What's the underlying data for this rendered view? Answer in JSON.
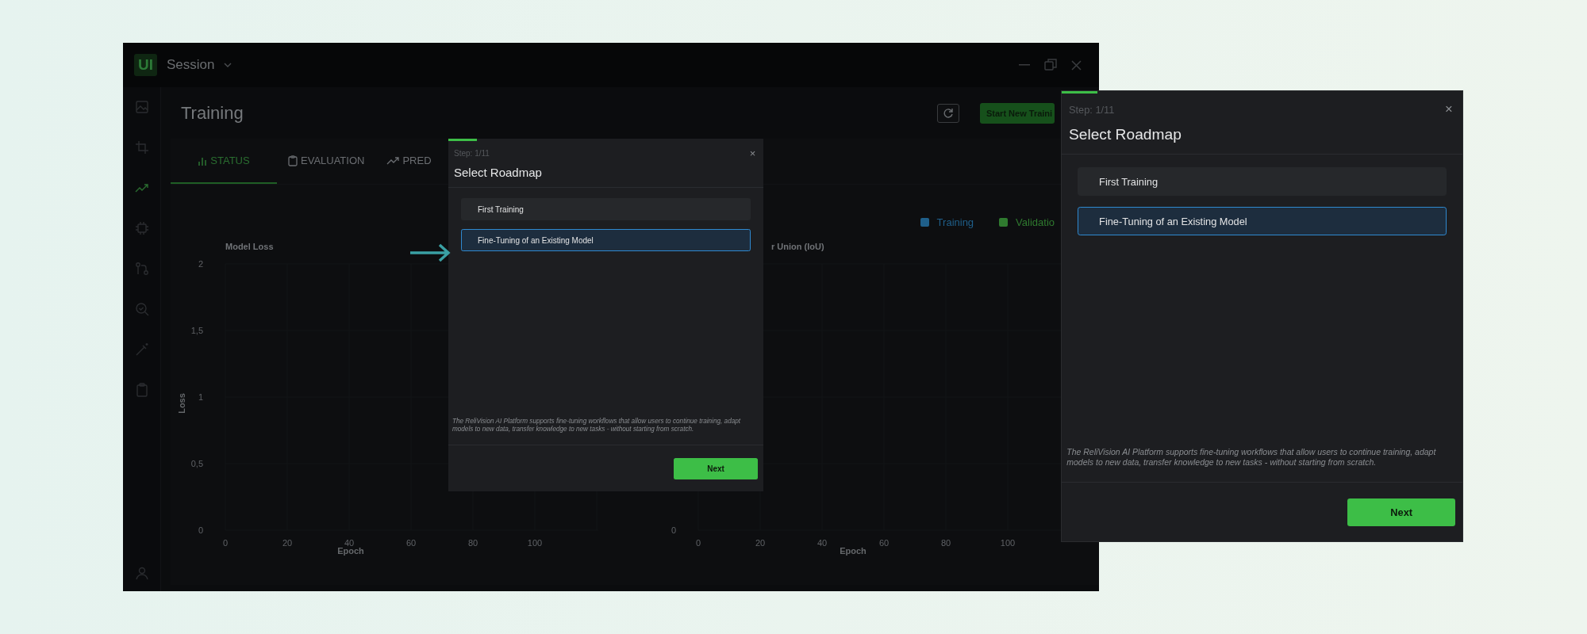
{
  "app": {
    "logo": "UI",
    "session": "Session",
    "sidebar": {
      "items": [
        {
          "selected": false
        },
        {
          "selected": false
        },
        {
          "selected": true
        },
        {
          "selected": false
        },
        {
          "selected": false
        },
        {
          "selected": false
        },
        {
          "selected": false
        },
        {
          "selected": false
        },
        {
          "selected": false
        }
      ]
    },
    "page_title": "Training",
    "start_button": "Start New Traini",
    "tabs": [
      {
        "label": "STATUS",
        "selected": true
      },
      {
        "label": "EVALUATION",
        "selected": false
      },
      {
        "label": "PRED",
        "selected": false
      }
    ],
    "legend": [
      {
        "label": "Training",
        "color": "#1f5f8a"
      },
      {
        "label": "Validatio",
        "color": "#2f7a2f"
      }
    ],
    "charts": [
      {
        "title": "Model Loss",
        "ylabel": "Loss",
        "xlabel": "Epoch",
        "xticks": [
          "0",
          "20",
          "40",
          "60",
          "80",
          "100"
        ],
        "yticks": [
          "2",
          "1,5",
          "1",
          "0,5",
          "0"
        ]
      },
      {
        "title": "r Union (IoU)",
        "xlabel": "Epoch",
        "xticks": [
          "0",
          "20",
          "40",
          "60",
          "80",
          "100"
        ],
        "yticks": [
          "0"
        ]
      }
    ]
  },
  "modal_dialog": {
    "level": 0.09,
    "step": "Step: 1/11",
    "close": "×",
    "title": "Select Roadmap",
    "options": [
      {
        "label": "First Training",
        "selected": false
      },
      {
        "label": "Fine-Tuning of an Existing Model",
        "selected": true
      }
    ],
    "description": "The ReliVision AI Platform supports fine-tuning workflows that allow users to continue training, adapt models to new data, transfer knowledge to new tasks - without starting from scratch.",
    "next": "Next"
  },
  "magnified_dialog": {
    "level": 0.09,
    "step": "Step: 1/11",
    "close": "×",
    "title": "Select Roadmap",
    "options": [
      {
        "label": "First Training",
        "selected": false
      },
      {
        "label": "Fine-Tuning of an Existing Model",
        "selected": true
      }
    ],
    "description": "The ReliVision AI Platform supports fine-tuning workflows that allow users to continue training, adapt models to new data, transfer knowledge to new tasks - without starting from scratch.",
    "next": "Next"
  }
}
